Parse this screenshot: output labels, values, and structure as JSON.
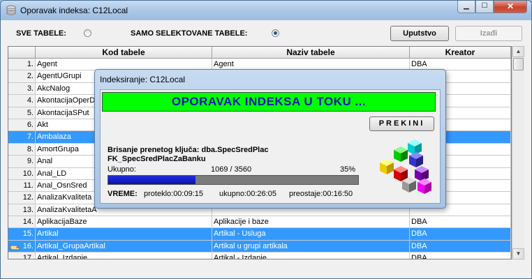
{
  "window": {
    "title": "Oporavak indeksa: C12Local",
    "close_glyph": "✕",
    "max_glyph": "☐",
    "min_glyph": "▁"
  },
  "options": {
    "all_tables_label": "SVE TABELE:",
    "selected_tables_label": "SAMO SELEKTOVANE TABELE:",
    "selected_option": "selected"
  },
  "toolbar": {
    "help_label": "Uputstvo",
    "exit_label": "Izađi"
  },
  "table": {
    "columns": [
      "Kod tabele",
      "Naziv tabele",
      "Kreator"
    ],
    "rows": [
      {
        "num": "1.",
        "kod": "Agent",
        "naziv": "Agent",
        "kreator": "DBA",
        "selected": false
      },
      {
        "num": "2.",
        "kod": "AgentUGrupi",
        "naziv": "",
        "kreator": "",
        "selected": false
      },
      {
        "num": "3.",
        "kod": "AkcNalog",
        "naziv": "",
        "kreator": "",
        "selected": false
      },
      {
        "num": "4.",
        "kod": "AkontacijaOperDo",
        "naziv": "",
        "kreator": "",
        "selected": false
      },
      {
        "num": "5.",
        "kod": "AkontacijaSPut",
        "naziv": "",
        "kreator": "",
        "selected": false
      },
      {
        "num": "6.",
        "kod": "Akt",
        "naziv": "",
        "kreator": "",
        "selected": false
      },
      {
        "num": "7.",
        "kod": "Ambalaza",
        "naziv": "",
        "kreator": "",
        "selected": true
      },
      {
        "num": "8.",
        "kod": "AmortGrupa",
        "naziv": "",
        "kreator": "",
        "selected": false
      },
      {
        "num": "9.",
        "kod": "Anal",
        "naziv": "",
        "kreator": "",
        "selected": false
      },
      {
        "num": "10.",
        "kod": "Anal_LD",
        "naziv": "",
        "kreator": "",
        "selected": false
      },
      {
        "num": "11.",
        "kod": "Anal_OsnSred",
        "naziv": "",
        "kreator": "",
        "selected": false
      },
      {
        "num": "12.",
        "kod": "AnalizaKvaliteta",
        "naziv": "",
        "kreator": "",
        "selected": false
      },
      {
        "num": "13.",
        "kod": "AnalizaKvalitetaA",
        "naziv": "",
        "kreator": "",
        "selected": false
      },
      {
        "num": "14.",
        "kod": "AplikacijaBaze",
        "naziv": "Aplikacije i baze",
        "kreator": "DBA",
        "selected": false
      },
      {
        "num": "15.",
        "kod": "Artikal",
        "naziv": "Artikal - Usluga",
        "kreator": "DBA",
        "selected": true
      },
      {
        "num": "16.",
        "kod": "Artikal_GrupaArtikal",
        "naziv": "Artikal u grupi artikala",
        "kreator": "DBA",
        "selected": true
      },
      {
        "num": "17.",
        "kod": "Artikal_Izdanje",
        "naziv": "Artikal - Izdanje",
        "kreator": "DBA",
        "selected": false
      }
    ]
  },
  "dialog": {
    "title": "Indeksiranje: C12Local",
    "banner": "OPORAVAK INDEKSA U TOKU ...",
    "stop_label": "PREKINI",
    "message_line1": "Brisanje prenetog ključa: dba.SpecSredPlac",
    "message_line2": "FK_SpecSredPlacZaBanku",
    "total_label": "Ukupno:",
    "counter": "1069 / 3560",
    "percent_text": "35%",
    "progress": 0.35,
    "time_label": "VREME:",
    "elapsed": "proteklo:00:09:15",
    "total_time": "ukupno:00:26:05",
    "remaining": "preostaje:00:16:50"
  },
  "colors": {
    "selection": "#3399ff",
    "banner_bg": "#00ff00",
    "banner_text": "#1515b8",
    "progress_fill": "#1a26cc"
  },
  "icons": {
    "app": "database-icon",
    "row_pointer": "hand-pointer-icon",
    "logo": "colored-cubes-logo"
  }
}
